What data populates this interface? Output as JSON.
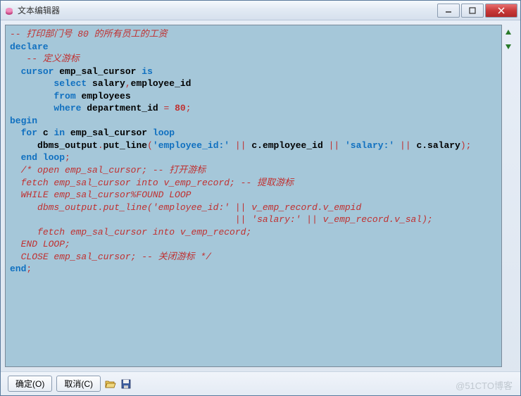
{
  "window": {
    "title": "文本编辑器"
  },
  "code": {
    "c1": "-- 打印部门号 80 的所有员工的工资",
    "kw_declare": "declare",
    "c2": "-- 定义游标",
    "kw_cursor": "cursor",
    "id_cursor": "emp_sal_cursor",
    "kw_is": "is",
    "kw_select": "select",
    "id_salary": "salary",
    "id_empid": "employee_id",
    "kw_from": "from",
    "id_employees": "employees",
    "kw_where": "where",
    "id_deptid": "department_id",
    "num_80": "80",
    "kw_begin": "begin",
    "kw_for": "for",
    "id_c": "c",
    "kw_in": "in",
    "kw_loop": "loop",
    "id_dbms": "dbms_output",
    "id_putline": "put_line",
    "str_empid": "'employee_id:'",
    "id_c_empid": "c.employee_id",
    "str_salary": "'salary:'",
    "id_c_salary": "c.salary",
    "kw_end": "end",
    "c_block1": "/* open emp_sal_cursor; -- 打开游标",
    "c_block2": "fetch emp_sal_cursor into v_emp_record; -- 提取游标",
    "c_block3": "WHILE emp_sal_cursor%FOUND LOOP",
    "c_block4": "   dbms_output.put_line('employee_id:' || v_emp_record.v_empid",
    "c_block5": "                                       || 'salary:' || v_emp_record.v_sal);",
    "c_block6": "   fetch emp_sal_cursor into v_emp_record;",
    "c_block7": "END LOOP;",
    "c_block8": "CLOSE emp_sal_cursor; -- 关闭游标 */",
    "kw_end2": "end"
  },
  "buttons": {
    "ok": "确定(O)",
    "cancel": "取消(C)"
  },
  "watermark": "@51CTO博客"
}
